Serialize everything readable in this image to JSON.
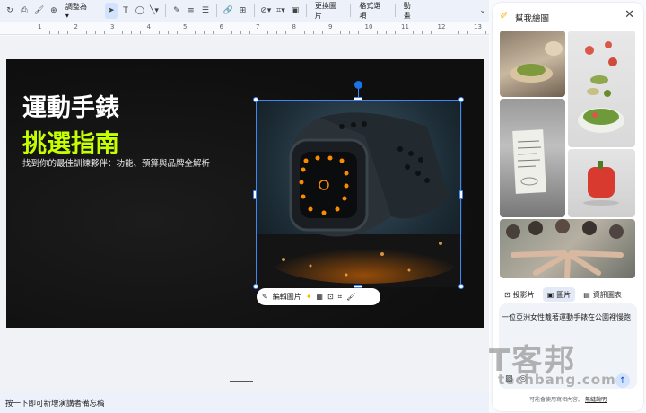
{
  "toolbar": {
    "zoom_label": "調整為",
    "replace_image": "更換圖片",
    "format_options": "格式選項",
    "animation": "動畫"
  },
  "ruler": {
    "numbers": [
      "1",
      "2",
      "3",
      "4",
      "5",
      "6",
      "7",
      "8",
      "9",
      "10",
      "11",
      "12",
      "13"
    ]
  },
  "slide": {
    "title_line1": "運動手錶",
    "title_line2": "挑選指南",
    "subtitle": "找到你的最佳訓練夥伴：功能、預算與品牌全解析",
    "title2_color": "#c6ff00"
  },
  "image_toolbar": {
    "edit_label": "編輯圖片"
  },
  "speaker_notes": {
    "placeholder": "按一下即可新增演講者備忘稿"
  },
  "panel": {
    "title": "幫我繪圖",
    "tabs": [
      {
        "label": "投影片",
        "icon": "slides-icon"
      },
      {
        "label": "圖片",
        "icon": "image-icon"
      },
      {
        "label": "資訊圖表",
        "icon": "infographic-icon"
      }
    ],
    "active_tab": "圖片",
    "prompt_text": "一位亞洲女性戴著運動手錶在公園裡慢跑",
    "disclaimer": "可能會使用寫相內容。",
    "disclaimer_link": "無縫說明"
  },
  "watermark": {
    "line1": "T客邦",
    "line2": "techbang.com"
  },
  "colors": {
    "accent": "#1a73e8",
    "toolbar_bg": "#edf2fa"
  }
}
